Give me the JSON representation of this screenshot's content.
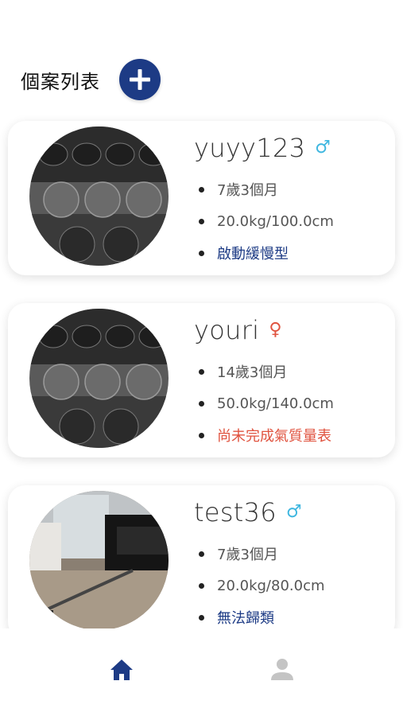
{
  "header": {
    "title": "個案列表",
    "add_icon": "plus-circle-icon"
  },
  "colors": {
    "primary": "#1d3b85",
    "male": "#3fb7e0",
    "female": "#e0533f",
    "status_blue": "#1d3b85",
    "status_red": "#e0533f",
    "inactive_nav": "#c4c4c4"
  },
  "cases": [
    {
      "name": "yuyy123",
      "gender_icon": "♂",
      "age": "7歲3個月",
      "body": "20.0kg/100.0cm",
      "status": "啟動緩慢型"
    },
    {
      "name": "youri",
      "gender_icon": "♀",
      "age": "14歲3個月",
      "body": "50.0kg/140.0cm",
      "status": "尚未完成氣質量表"
    },
    {
      "name": "test36",
      "gender_icon": "♂",
      "age": "7歲3個月",
      "body": "20.0kg/80.0cm",
      "status": "無法歸類"
    }
  ],
  "nav": {
    "items": [
      {
        "icon": "home-icon",
        "active": true
      },
      {
        "icon": "person-icon",
        "active": false
      }
    ]
  }
}
